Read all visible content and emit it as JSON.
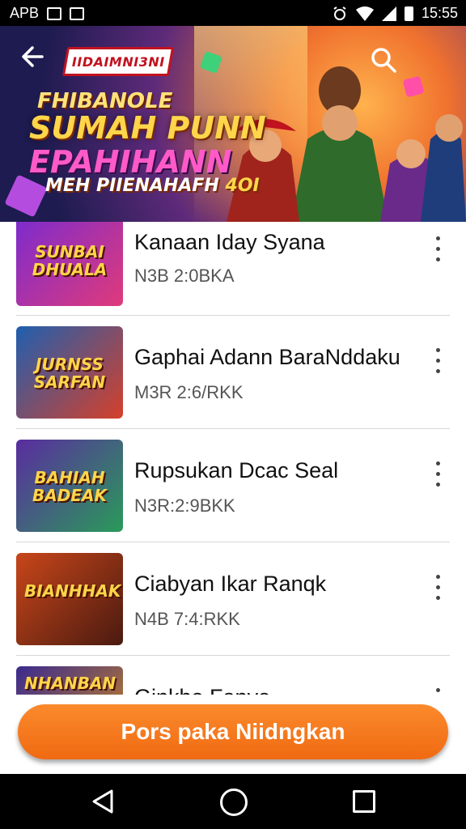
{
  "status_bar": {
    "left_text": "APB",
    "time": "15:55"
  },
  "banner": {
    "logo_text": "IIDAIMNI3NI",
    "line1": "FHIBANOLE",
    "line2": "SUMAH PUNN",
    "line3": "EPAHIHANN",
    "line4_a": "MEH PIIENAHAFH",
    "line4_b": "4OI"
  },
  "list": {
    "items": [
      {
        "title": "Kanaan Iday Syana",
        "meta": "N3B 2:0BKA",
        "thumb_text": "SUNBAI DHUALA",
        "thumb_bg": "#7a2bd0"
      },
      {
        "title": "Gaphai Adann BaraNddaku",
        "meta": "M3R 2:6/RKK",
        "thumb_text": "JURNSS SARFAN",
        "thumb_bg": "#1f5fb0"
      },
      {
        "title": "Rupsukan Dcac Seal",
        "meta": "N3R:2:9BKK",
        "thumb_text": "BAHIAH BADEAK",
        "thumb_bg": "#5a2ca0"
      },
      {
        "title": "Ciabyan Ikar Ranqk",
        "meta": "N4B 7:4:RKK",
        "thumb_text": "BIANHHAK",
        "thumb_bg": "#c8461a"
      },
      {
        "title": "Ginkhe Fanye",
        "meta": "",
        "thumb_text": "NHANBAN",
        "thumb_bg": "#3b2a8f"
      }
    ]
  },
  "cta": {
    "label": "Pors paka Niidngkan",
    "color": "#f27a1e"
  }
}
